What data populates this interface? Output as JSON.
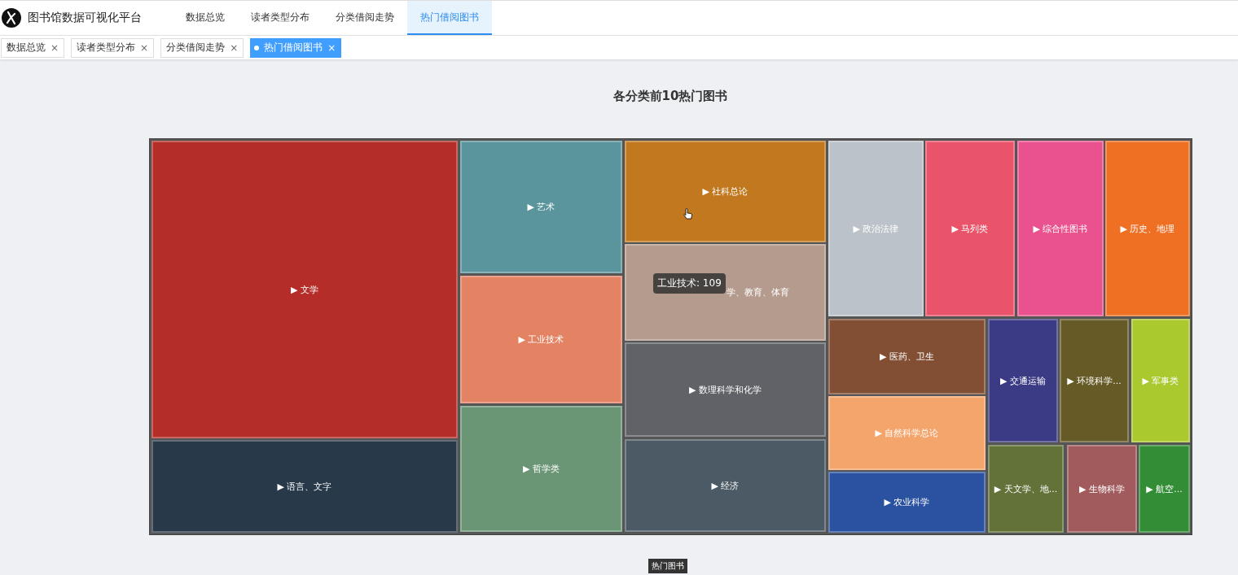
{
  "app": {
    "title": "图书馆数据可视化平台"
  },
  "nav": [
    {
      "label": "数据总览",
      "selected": false
    },
    {
      "label": "读者类型分布",
      "selected": false
    },
    {
      "label": "分类借阅走势",
      "selected": false
    },
    {
      "label": "热门借阅图书",
      "selected": true
    }
  ],
  "tags": [
    {
      "label": "数据总览",
      "close": "×",
      "selected": false
    },
    {
      "label": "读者类型分布",
      "close": "×",
      "selected": false
    },
    {
      "label": "分类借阅走势",
      "close": "×",
      "selected": false
    },
    {
      "label": "热门借阅图书",
      "close": "×",
      "selected": true
    }
  ],
  "chart": {
    "title": "各分类前10热门图书",
    "tiles": [
      {
        "label": "▶ 文学",
        "color": "#b52d28"
      },
      {
        "label": "▶ 语言、文字",
        "color": "#283a4a"
      },
      {
        "label": "▶ 艺术",
        "color": "#5a959d"
      },
      {
        "label": "▶ 工业技术",
        "color": "#e48264"
      },
      {
        "label": "▶ 哲学类",
        "color": "#6b9676"
      },
      {
        "label": "▶ 社科总论",
        "color": "#c2781e"
      },
      {
        "label": "学、教育、体育",
        "color": "#b59b8e"
      },
      {
        "label": "▶ 数理科学和化学",
        "color": "#606267"
      },
      {
        "label": "▶ 经济",
        "color": "#4b5a64"
      },
      {
        "label": "▶ 政治法律",
        "color": "#bbc2c9"
      },
      {
        "label": "▶ 马列类",
        "color": "#e9546a"
      },
      {
        "label": "▶ 综合性图书",
        "color": "#e9528e"
      },
      {
        "label": "▶ 历史、地理",
        "color": "#ef6f23"
      },
      {
        "label": "▶ 医药、卫生",
        "color": "#824f34"
      },
      {
        "label": "▶ 自然科学总论",
        "color": "#f4a56c"
      },
      {
        "label": "▶ 农业科学",
        "color": "#2b52a0"
      },
      {
        "label": "▶ 交通运输",
        "color": "#3b3a85"
      },
      {
        "label": "▶ 环境科学...",
        "color": "#665a27"
      },
      {
        "label": "▶ 军事类",
        "color": "#a9c92f"
      },
      {
        "label": "▶ 天文学、地...",
        "color": "#627238"
      },
      {
        "label": "▶ 生物科学",
        "color": "#a15b5c"
      },
      {
        "label": "▶ 航空...",
        "color": "#338c36"
      }
    ],
    "tooltip": "工业技术: 109",
    "breadcrumb": "热门图书"
  }
}
